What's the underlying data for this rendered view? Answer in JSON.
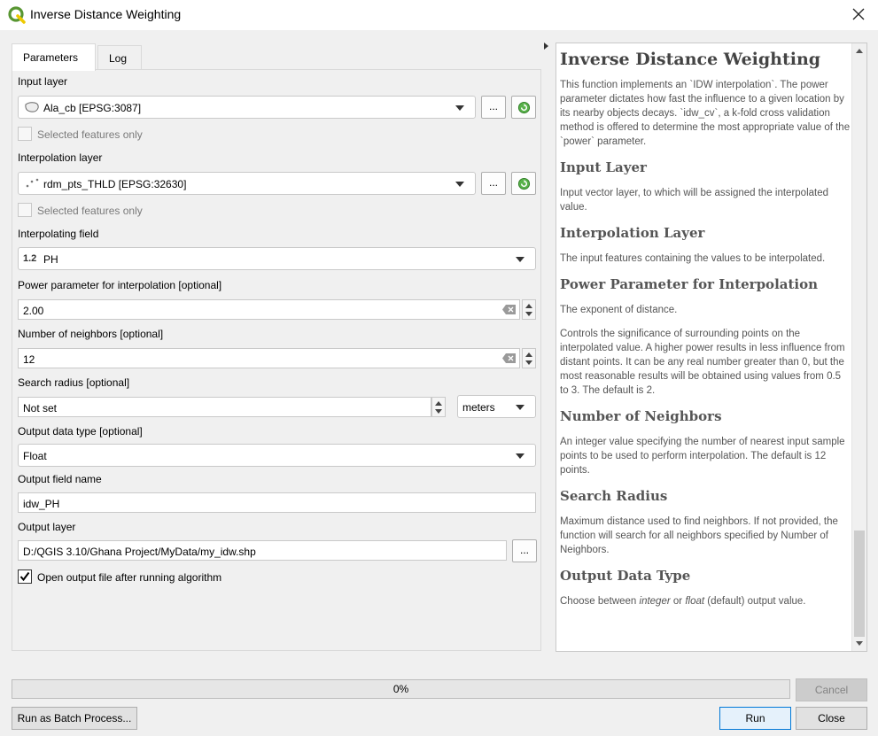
{
  "window": {
    "title": "Inverse Distance Weighting"
  },
  "tabs": [
    {
      "label": "Parameters",
      "active": true
    },
    {
      "label": "Log",
      "active": false
    }
  ],
  "params": {
    "input_layer": {
      "label": "Input layer",
      "value": "Ala_cb [EPSG:3087]",
      "browse": "...",
      "selected_only": "Selected features only"
    },
    "interpolation_layer": {
      "label": "Interpolation layer",
      "value": "rdm_pts_THLD [EPSG:32630]",
      "browse": "...",
      "selected_only": "Selected features only"
    },
    "interpolating_field": {
      "label": "Interpolating field",
      "type_badge": "1.2",
      "value": "PH"
    },
    "power": {
      "label": "Power parameter for interpolation [optional]",
      "value": "2.00"
    },
    "neighbors": {
      "label": "Number of neighbors [optional]",
      "value": "12"
    },
    "search_radius": {
      "label": "Search radius [optional]",
      "value": "Not set",
      "unit": "meters"
    },
    "output_type": {
      "label": "Output data type [optional]",
      "value": "Float"
    },
    "output_field": {
      "label": "Output field name",
      "value": "idw_PH"
    },
    "output_layer": {
      "label": "Output layer",
      "value": "D:/QGIS 3.10/Ghana Project/MyData/my_idw.shp",
      "browse": "..."
    },
    "open_output": {
      "label": "Open output file after running algorithm",
      "checked": true
    }
  },
  "help": {
    "title": "Inverse Distance Weighting",
    "intro": "This function implements an `IDW interpolation`. The power parameter dictates how fast the influence to a given location by its nearby objects decays. `idw_cv`, a k-fold cross validation method is offered to determine the most appropriate value of the `power` parameter.",
    "sections": [
      {
        "heading": "Input Layer",
        "text": "Input vector layer, to which will be assigned the interpolated value."
      },
      {
        "heading": "Interpolation Layer",
        "text": "The input features containing the values to be interpolated."
      },
      {
        "heading": "Power Parameter for Interpolation",
        "text": "The exponent of distance.",
        "text2": "Controls the significance of surrounding points on the interpolated value. A higher power results in less influence from distant points. It can be any real number greater than 0, but the most reasonable results will be obtained using values from 0.5 to 3. The default is 2."
      },
      {
        "heading": "Number of Neighbors",
        "text": "An integer value specifying the number of nearest input sample points to be used to perform interpolation. The default is 12 points."
      },
      {
        "heading": "Search Radius",
        "text": "Maximum distance used to find neighbors. If not provided, the function will search for all neighbors specified by Number of Neighbors."
      },
      {
        "heading": "Output Data Type",
        "text_pre": "Choose between ",
        "em1": "integer",
        "text_mid": " or ",
        "em2": "float",
        "text_post": " (default) output value."
      }
    ]
  },
  "footer": {
    "progress": 0,
    "progress_label": "0%",
    "cancel": "Cancel",
    "batch": "Run as Batch Process...",
    "run": "Run",
    "close": "Close"
  },
  "colors": {
    "qgis_green": "#589632",
    "qgis_yellow": "#eec900",
    "default_button_border": "#0078d7"
  }
}
